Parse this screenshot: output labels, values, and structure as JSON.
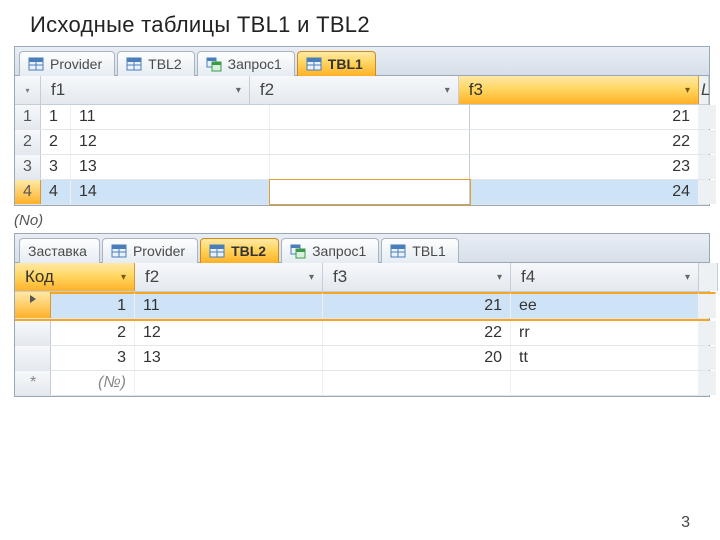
{
  "title": "Исходные таблицы TBL1 и TBL2",
  "slideNumber": "3",
  "tbl1": {
    "tabs": [
      {
        "label": "Provider",
        "active": false,
        "kind": "table"
      },
      {
        "label": "TBL2",
        "active": false,
        "kind": "table"
      },
      {
        "label": "Запрос1",
        "active": false,
        "kind": "query"
      },
      {
        "label": "TBL1",
        "active": true,
        "kind": "table"
      }
    ],
    "columns": [
      {
        "label": "f1",
        "active": false
      },
      {
        "label": "f2",
        "active": false
      },
      {
        "label": "f3",
        "active": true
      }
    ],
    "extraColHint": "L",
    "rows": [
      {
        "n": "1",
        "f1": "1",
        "f2": "11",
        "f3": "21",
        "selected": false
      },
      {
        "n": "2",
        "f1": "2",
        "f2": "12",
        "f3": "22",
        "selected": false
      },
      {
        "n": "3",
        "f1": "3",
        "f2": "13",
        "f3": "23",
        "selected": false
      },
      {
        "n": "4",
        "f1": "4",
        "f2": "14",
        "f3": "24",
        "selected": true
      }
    ],
    "newRowLabel": "(No)"
  },
  "tbl2": {
    "tabs": [
      {
        "label": "Заставка",
        "active": false,
        "kind": "form"
      },
      {
        "label": "Provider",
        "active": false,
        "kind": "table"
      },
      {
        "label": "TBL2",
        "active": true,
        "kind": "table"
      },
      {
        "label": "Запрос1",
        "active": false,
        "kind": "query"
      },
      {
        "label": "TBL1",
        "active": false,
        "kind": "table"
      }
    ],
    "columns": [
      {
        "label": "Код",
        "active": true
      },
      {
        "label": "f2",
        "active": false
      },
      {
        "label": "f3",
        "active": false
      },
      {
        "label": "f4",
        "active": false
      }
    ],
    "rows": [
      {
        "kod": "1",
        "f2": "11",
        "f3": "21",
        "f4": "ee",
        "selected": true
      },
      {
        "kod": "2",
        "f2": "12",
        "f3": "22",
        "f4": "rr",
        "selected": false
      },
      {
        "kod": "3",
        "f2": "13",
        "f3": "20",
        "f4": "tt",
        "selected": false
      }
    ],
    "newRowLabel": "(№)"
  }
}
